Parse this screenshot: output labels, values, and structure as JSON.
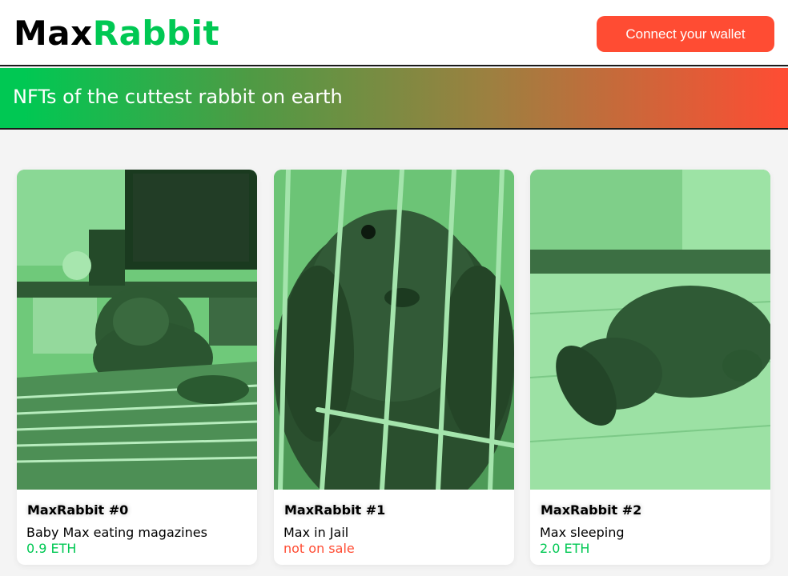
{
  "header": {
    "logo_part1": "Max",
    "logo_part2": "Rabbit",
    "connect_label": "Connect your wallet"
  },
  "banner": {
    "text": "NFTs of the cuttest rabbit on earth"
  },
  "colors": {
    "green": "#00c853",
    "red": "#ff4c33"
  },
  "cards": [
    {
      "title": "MaxRabbit #0",
      "description": "Baby Max eating magazines",
      "price": "0.9 ETH",
      "price_status": "on-sale"
    },
    {
      "title": "MaxRabbit #1",
      "description": "Max in Jail",
      "price": "not on sale",
      "price_status": "not-on-sale"
    },
    {
      "title": "MaxRabbit #2",
      "description": "Max sleeping",
      "price": "2.0 ETH",
      "price_status": "on-sale"
    }
  ]
}
